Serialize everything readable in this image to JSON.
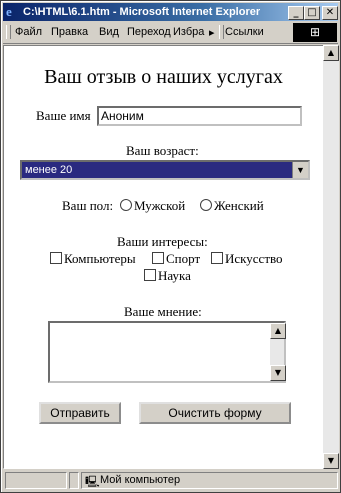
{
  "window": {
    "title": "C:\\HTML\\6.1.htm - Microsoft Internet Explorer",
    "controls": {
      "minimize": "_",
      "maximize": "□",
      "close": "✕"
    }
  },
  "menubar": {
    "items": [
      "Файл",
      "Правка",
      "Вид",
      "Переход",
      "Избра"
    ],
    "overflow": "▸",
    "links_label": "Ссылки"
  },
  "form": {
    "heading": "Ваш отзыв о наших услугах",
    "name_label": "Ваше имя",
    "name_value": "Аноним",
    "age_label": "Ваш возраст:",
    "age_selected": "менее 20",
    "gender_label": "Ваш пол:",
    "gender_options": [
      "Мужской",
      "Женский"
    ],
    "interests_label": "Ваши интересы:",
    "interests": [
      "Компьютеры",
      "Спорт",
      "Искусство",
      "Наука"
    ],
    "opinion_label": "Ваше мнение:",
    "submit_label": "Отправить",
    "reset_label": "Очистить форму"
  },
  "statusbar": {
    "zone_text": "Мой компьютер"
  },
  "colors": {
    "title_start": "#0a246a",
    "title_end": "#a6caf0",
    "select_bg": "#2a2a80",
    "chrome": "#d4d0c8"
  }
}
